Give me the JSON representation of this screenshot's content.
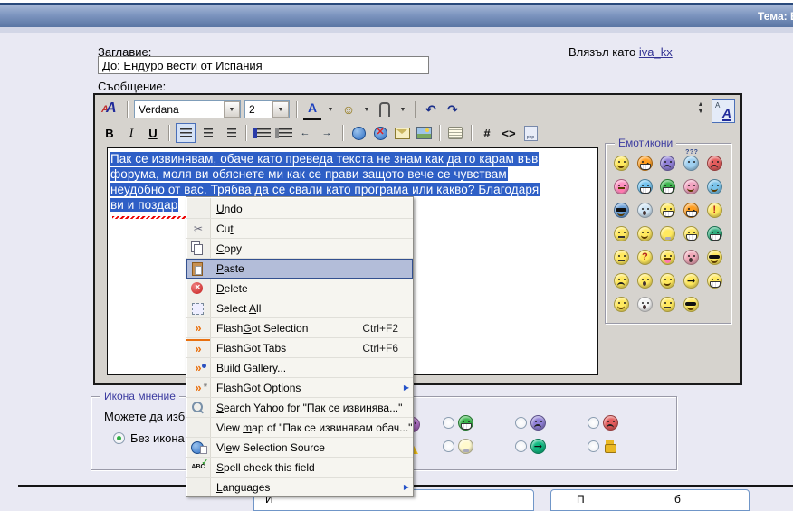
{
  "titlebar": {
    "title": "Тема: Е"
  },
  "header": {
    "subject_label": "Заглавие:",
    "subject_value": "До: Ендуро вести от Испания",
    "logged_in_label": "Влязъл като",
    "username": "iva_kx",
    "message_label": "Съобщение:"
  },
  "toolbar": {
    "font_name": "Verdana",
    "font_size": "2",
    "glyphs": {
      "bold": "B",
      "italic": "I",
      "underline": "U",
      "smiley": "☺",
      "undo": "↶",
      "redo": "↷",
      "hash": "#",
      "code": "<>",
      "php": "php",
      "color": "A",
      "outdent": "←",
      "indent": "→",
      "spin_up": "▲",
      "spin_down": "▼"
    },
    "row1_icons": [
      "bbcode-toggle",
      "font-family-select",
      "font-size-select",
      "font-color",
      "emoticon-menu",
      "attach",
      "undo",
      "redo",
      "resize-spinner",
      "editor-mode-toggle"
    ],
    "row2_icons": [
      "bold",
      "italic",
      "underline",
      "align-left",
      "align-center",
      "align-right",
      "ordered-list",
      "unordered-list",
      "outdent",
      "indent",
      "insert-link",
      "remove-link",
      "insert-email",
      "insert-image",
      "quote",
      "hash",
      "code",
      "php"
    ]
  },
  "editor": {
    "selection_color": "#2e5fc6",
    "lines": [
      "Пак се извинявам, обаче като преведа текста не знам как да го карам във",
      "форума, моля ви обяснете ми как се прави защото вече се чувствам",
      "неудобно от вас. Трябва да се свали като програма или какво? Благодаря",
      "ви и поздар"
    ]
  },
  "emoticons_panel": {
    "legend": "Емотикони",
    "items": [
      {
        "c": "#ffe95e",
        "t": "smile"
      },
      {
        "c": "#ff9d1e",
        "t": "evil"
      },
      {
        "c": "#8f7fd6",
        "t": "frown"
      },
      {
        "c": "#9fd0f0",
        "t": "huh"
      },
      {
        "c": "#e45c5c",
        "t": "frown"
      },
      {
        "c": "#ff8fc0",
        "t": "tongue"
      },
      {
        "c": "#6fc2f0",
        "t": "laugh"
      },
      {
        "c": "#39b54a",
        "t": "grin"
      },
      {
        "c": "#f2a3c0",
        "t": "smile"
      },
      {
        "c": "#79c3ea",
        "t": "wink"
      },
      {
        "c": "#6a9fd8",
        "t": "shades"
      },
      {
        "c": "#cfe4f4",
        "t": "shock"
      },
      {
        "c": "#ffe95e",
        "t": "laugh"
      },
      {
        "c": "#ff9d1e",
        "t": "evil"
      },
      {
        "c": "#ffe95e",
        "t": "excl"
      },
      {
        "c": "#ffe95e",
        "t": "flat"
      },
      {
        "c": "#ffe95e",
        "t": "smile"
      },
      {
        "c": "#ffe95e",
        "t": "bulb"
      },
      {
        "c": "#ffe95e",
        "t": "grin"
      },
      {
        "c": "#2fae7e",
        "t": "grin"
      },
      {
        "c": "#ffe95e",
        "t": "flat"
      },
      {
        "c": "#ffe95e",
        "t": "quest"
      },
      {
        "c": "#ffe95e",
        "t": "tongue"
      },
      {
        "c": "#f0a8b8",
        "t": "shock"
      },
      {
        "c": "#ffe95e",
        "t": "shades"
      },
      {
        "c": "#ffe95e",
        "t": "frown"
      },
      {
        "c": "#ffe95e",
        "t": "shock"
      },
      {
        "c": "#ffe95e",
        "t": "smile"
      },
      {
        "c": "#ffe95e",
        "t": "arrow"
      },
      {
        "c": "#ffe95e",
        "t": "grin"
      },
      {
        "c": "#ffe95e",
        "t": "smile"
      },
      {
        "c": "#f4f4f4",
        "t": "shock"
      },
      {
        "c": "#ffe95e",
        "t": "flat"
      },
      {
        "c": "#ffe95e",
        "t": "shades"
      }
    ]
  },
  "context_menu": {
    "highlight_color": "#b3bdd9",
    "items": [
      {
        "label": "Undo",
        "u": 0,
        "icon": "undo"
      },
      {
        "label": "Cut",
        "u": 2,
        "icon": "cut",
        "glyph": "✂"
      },
      {
        "label": "Copy",
        "u": 0,
        "icon": "copy"
      },
      {
        "label": "Paste",
        "u": 0,
        "icon": "paste",
        "highlight": true
      },
      {
        "label": "Delete",
        "u": 0,
        "icon": "delete"
      },
      {
        "label": "Select All",
        "u": 7,
        "icon": "select-all"
      },
      {
        "label": "FlashGot Selection",
        "u": 5,
        "icon": "flashgot",
        "glyph": "»",
        "accel": "Ctrl+F2"
      },
      {
        "label": "FlashGot Tabs",
        "u": -1,
        "icon": "flashgot-tabs",
        "glyph": "»",
        "accel": "Ctrl+F6"
      },
      {
        "label": "Build Gallery...",
        "u": -1,
        "icon": "gallery",
        "glyph": "»"
      },
      {
        "label": "FlashGot Options",
        "u": -1,
        "icon": "options",
        "glyph": "»",
        "submenu": true
      },
      {
        "label": "Search Yahoo for \"Пак се извинява...\"",
        "u": 0,
        "icon": "search"
      },
      {
        "label": "View map of \"Пак се извинявам обач...\"",
        "u": 5,
        "icon": null
      },
      {
        "label": "View Selection Source",
        "u": 2,
        "icon": "view-source"
      },
      {
        "label": "Spell check this field",
        "u": 0,
        "icon": "spellcheck",
        "glyph": "ABC"
      },
      {
        "label": "Languages",
        "u": 0,
        "icon": null,
        "submenu": true
      }
    ]
  },
  "post_icon_panel": {
    "legend": "Икона мнение",
    "intro": "Можете да изб",
    "no_icon_label": "Без икона",
    "options": [
      {
        "c": "#39b54a",
        "t": "grin"
      },
      {
        "c": "#fffacd",
        "t": "bulb"
      },
      {
        "c": "#8f7fd6",
        "t": "frown"
      },
      {
        "c": "#10b981",
        "t": "arrow"
      },
      {
        "c": "#e45c5c",
        "t": "frown"
      },
      {
        "c": "#eab824",
        "t": "thumb"
      }
    ],
    "partial_icons": [
      {
        "c": "#b06cc8",
        "t": "shock"
      },
      {
        "c": "#ffd84d",
        "t": "warn"
      }
    ]
  },
  "bottom": {
    "submit_fragment": "И",
    "preview_fragment_1": "П",
    "preview_fragment_2": "б"
  }
}
